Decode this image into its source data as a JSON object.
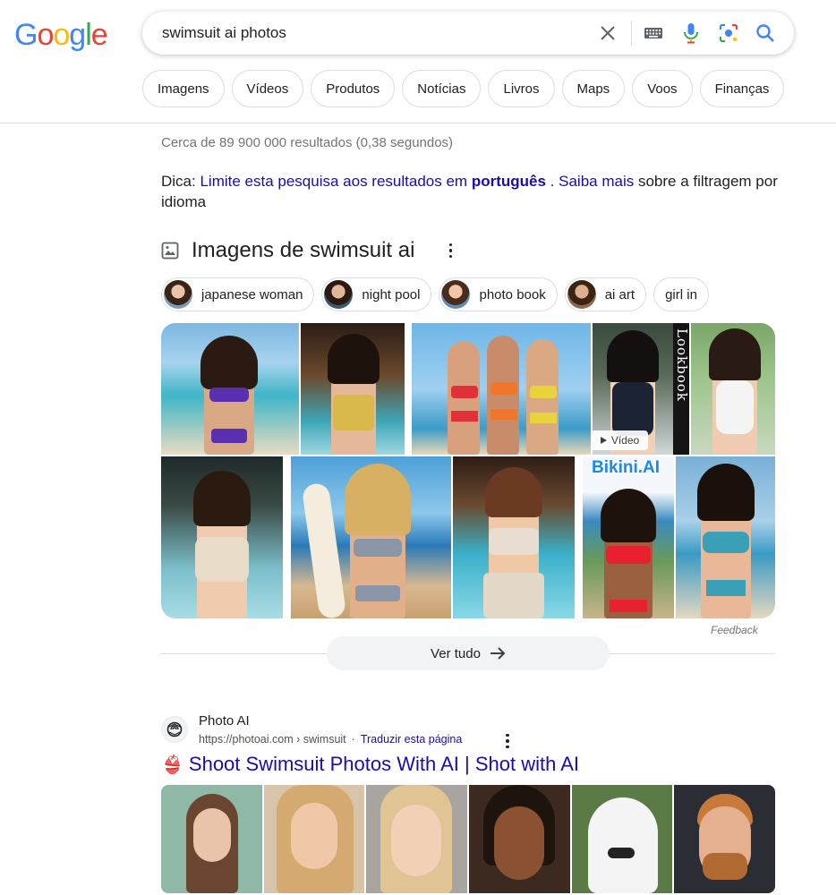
{
  "logo": {
    "letters": [
      "G",
      "o",
      "o",
      "g",
      "l",
      "e"
    ],
    "colors": [
      "#4285F4",
      "#EA4335",
      "#FBBC05",
      "#4285F4",
      "#34A853",
      "#EA4335"
    ]
  },
  "search": {
    "query": "swimsuit ai photos",
    "icons": [
      "close-icon",
      "keyboard-icon",
      "mic-icon",
      "lens-icon",
      "search-icon"
    ]
  },
  "nav": {
    "chips": [
      "Imagens",
      "Vídeos",
      "Produtos",
      "Notícias",
      "Livros",
      "Maps",
      "Voos",
      "Finanças"
    ]
  },
  "stats": "Cerca de 89 900 000 resultados (0,38 segundos)",
  "tip": {
    "prefix": "Dica:",
    "link1": "Limite esta pesquisa aos resultados em",
    "lang": "português",
    "dot": ".",
    "link2": "Saiba mais",
    "suffix": "sobre a filtragem por idioma"
  },
  "images_section": {
    "title": "Imagens de swimsuit ai",
    "refinements": [
      "japanese woman",
      "night pool",
      "photo book",
      "ai art",
      "girl in"
    ],
    "video_badge": "Vídeo",
    "lookbook_text": "AI Girls Lookbook",
    "bikini_brand": "Bikini.AI",
    "feedback": "Feedback",
    "see_all": "Ver tudo"
  },
  "result": {
    "site_name": "Photo AI",
    "url": "https://photoai.com › swimsuit",
    "translate": "Traduzir esta página",
    "emoji": "👙",
    "title": "Shoot Swimsuit Photos With AI | Shot with AI"
  },
  "colors": {
    "link": "#1a0dab",
    "muted": "#70757a",
    "border": "#dadce0"
  }
}
